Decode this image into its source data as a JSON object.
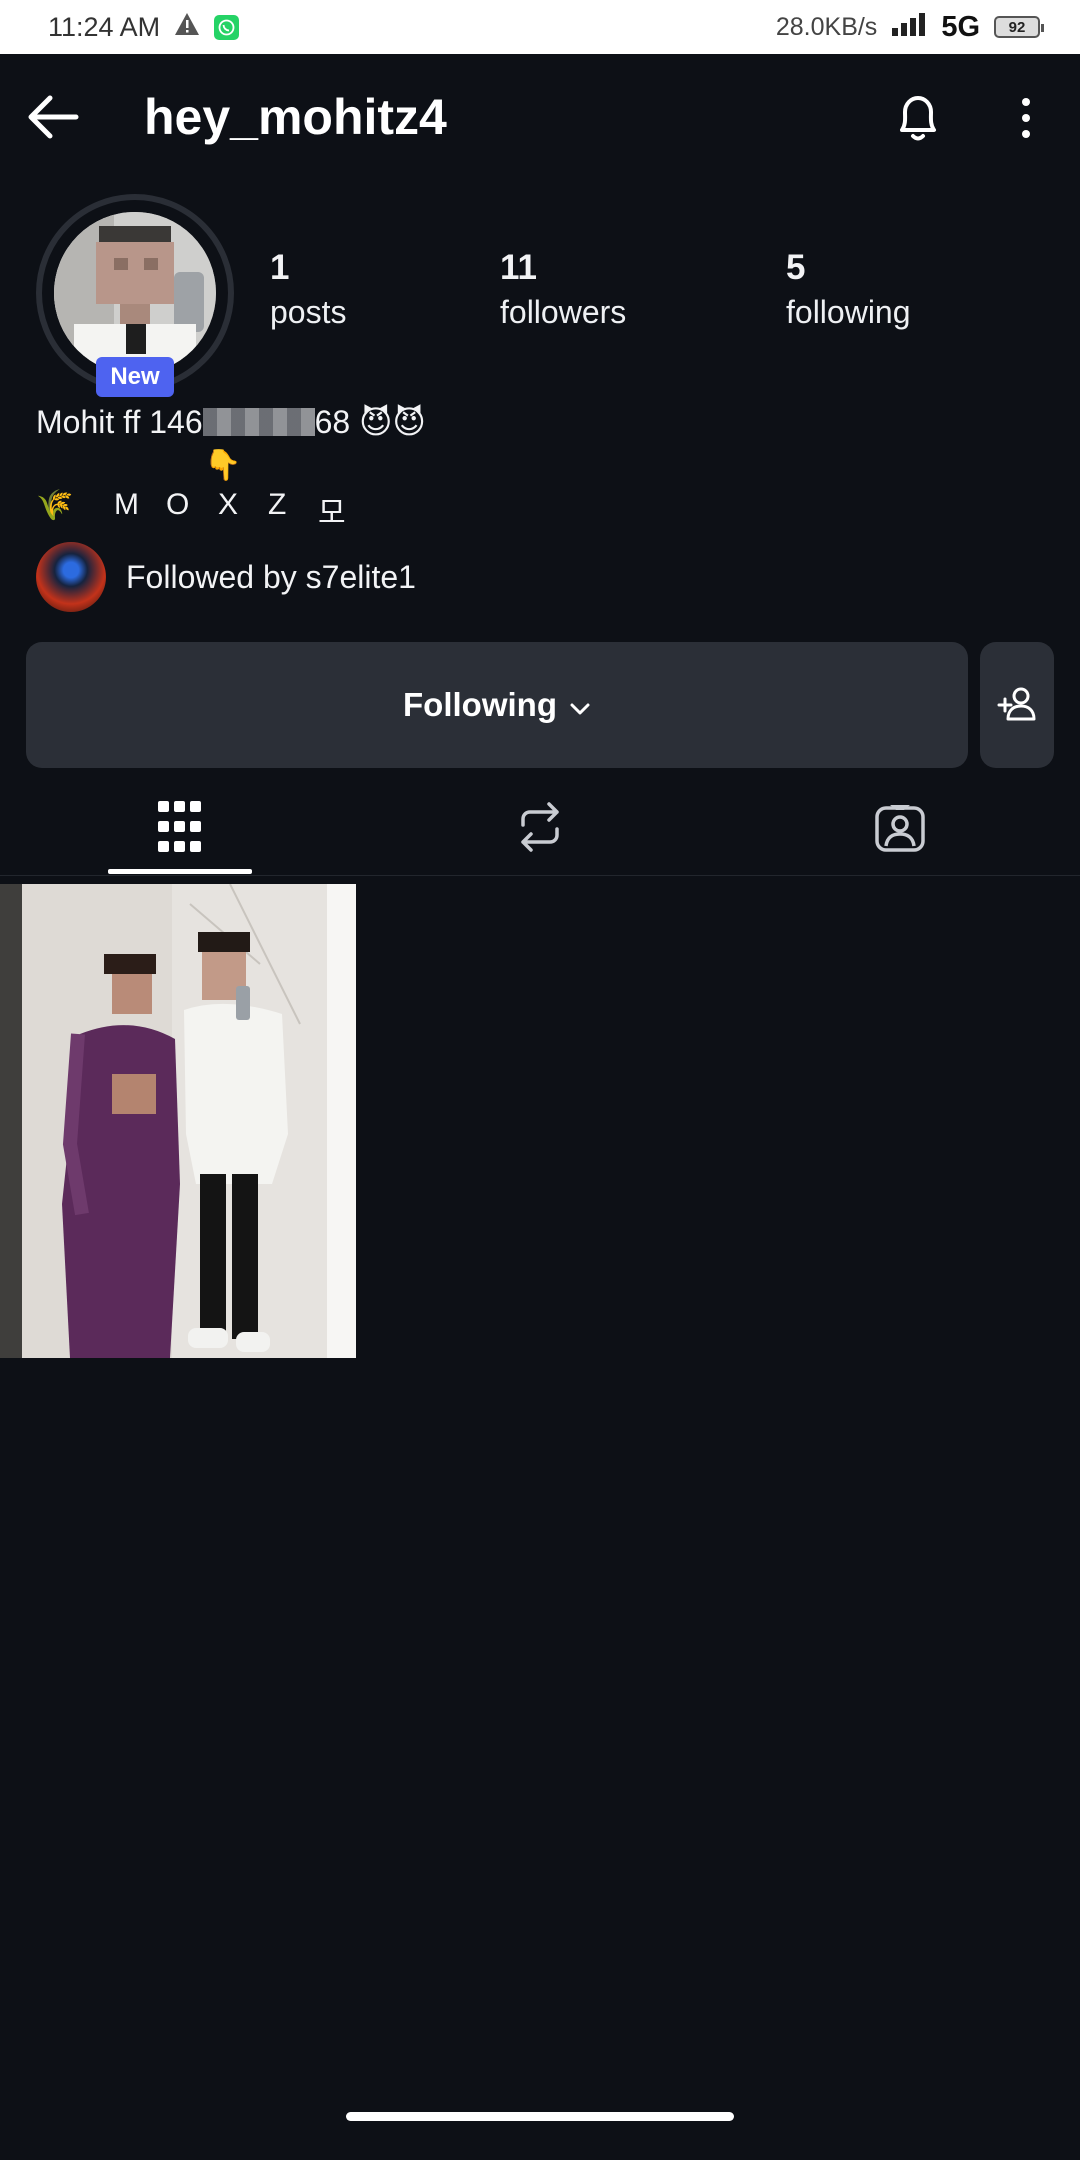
{
  "status_bar": {
    "time": "11:24 AM",
    "net_speed": "28.0KB/s",
    "network": "5G",
    "battery": "92"
  },
  "header": {
    "username": "hey_mohitz4"
  },
  "profile": {
    "avatar_badge": "New",
    "stats": [
      {
        "value": "1",
        "label": "posts"
      },
      {
        "value": "11",
        "label": "followers"
      },
      {
        "value": "5",
        "label": "following"
      }
    ],
    "bio_line1_start": "Mohit  ff 146",
    "bio_line1_end": "68 😈😈",
    "bio_emoji": "👇",
    "bio_line2": [
      "🌾",
      "M",
      "O",
      "X",
      "Z",
      "모"
    ],
    "followed_by": "Followed by s7elite1"
  },
  "actions": {
    "following_label": "Following"
  },
  "tabs": [
    {
      "name": "posts-grid",
      "active": true
    },
    {
      "name": "reposts",
      "active": false
    },
    {
      "name": "tagged",
      "active": false
    }
  ],
  "colors": {
    "background": "#0d1016",
    "button": "#2b2f37",
    "badge": "#4e63f0"
  }
}
